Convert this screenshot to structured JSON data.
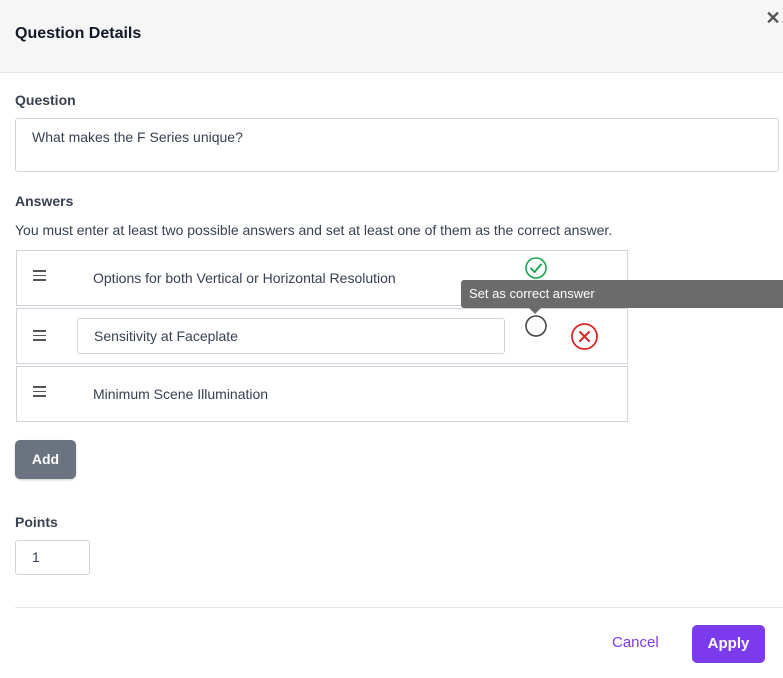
{
  "header": {
    "title": "Question Details",
    "close_glyph": "✕"
  },
  "question": {
    "label": "Question",
    "value": "What makes the F Series unique?"
  },
  "answers": {
    "label": "Answers",
    "hint": "You must enter at least two possible answers and set at least one of them as the correct answer.",
    "items": [
      {
        "text": "Options for both Vertical or Horizontal Resolution",
        "correct": true,
        "editing": false
      },
      {
        "text": "Sensitivity at Faceplate",
        "correct": false,
        "editing": true
      },
      {
        "text": "Minimum Scene Illumination",
        "correct": false,
        "editing": false
      }
    ],
    "tooltip": "Set as correct answer",
    "add_label": "Add"
  },
  "points": {
    "label": "Points",
    "value": "1"
  },
  "footer": {
    "cancel_label": "Cancel",
    "apply_label": "Apply"
  },
  "colors": {
    "accent": "#7c3aed",
    "correct": "#16a34a",
    "delete": "#dc2626",
    "add_button": "#6b7280",
    "tooltip_bg": "#6b6b6b"
  },
  "icons": {
    "close": "close-icon",
    "drag": "drag-handle-icon",
    "correct": "check-circle-icon",
    "mark_correct": "empty-circle-icon",
    "delete": "x-circle-icon"
  }
}
